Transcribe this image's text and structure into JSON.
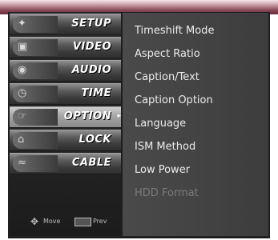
{
  "colors": {
    "left_panel": "#2e2e2e",
    "right_panel": "#444444",
    "text_normal": "#ececec",
    "text_disabled": "#7a7a7a",
    "top_bar": "#8a4a58"
  },
  "menu": {
    "items": [
      {
        "label": "SETUP",
        "icon": "setup-icon"
      },
      {
        "label": "VIDEO",
        "icon": "video-icon"
      },
      {
        "label": "AUDIO",
        "icon": "audio-icon"
      },
      {
        "label": "TIME",
        "icon": "time-icon"
      },
      {
        "label": "OPTION",
        "icon": "option-icon",
        "selected": true
      },
      {
        "label": "LOCK",
        "icon": "lock-icon"
      },
      {
        "label": "CABLE",
        "icon": "cable-icon"
      }
    ]
  },
  "submenu": {
    "items": [
      {
        "label": "Timeshift Mode",
        "state": "normal"
      },
      {
        "label": "Aspect Ratio",
        "state": "normal"
      },
      {
        "label": "Caption/Text",
        "state": "normal"
      },
      {
        "label": "Caption Option",
        "state": "normal"
      },
      {
        "label": "Language",
        "state": "normal"
      },
      {
        "label": "ISM Method",
        "state": "normal"
      },
      {
        "label": "Low Power",
        "state": "normal"
      },
      {
        "label": "HDD Format",
        "state": "disabled"
      }
    ]
  },
  "footer": {
    "move_label": "Move",
    "prev_label": "Prev"
  }
}
